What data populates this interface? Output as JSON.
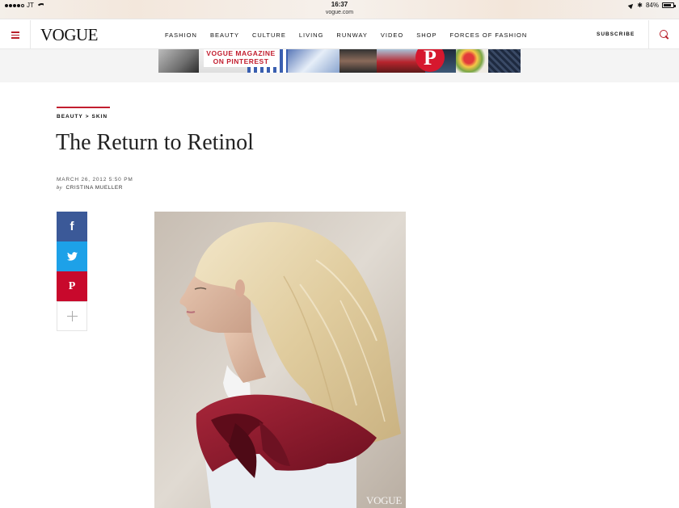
{
  "status_bar": {
    "carrier": "JT",
    "time": "16:37",
    "url": "vogue.com",
    "battery_percent": "84%",
    "battery_level": 0.84
  },
  "header": {
    "logo": "VOGUE",
    "nav": [
      "FASHION",
      "BEAUTY",
      "CULTURE",
      "LIVING",
      "RUNWAY",
      "VIDEO",
      "SHOP",
      "FORCES OF FASHION"
    ],
    "subscribe_label": "SUBSCRIBE",
    "accent_color": "#c21e2f"
  },
  "ad": {
    "title_line1": "VOGUE MAGAZINE",
    "title_line2": "ON PINTEREST",
    "pinterest_glyph": "P"
  },
  "article": {
    "breadcrumb_section": "BEAUTY",
    "breadcrumb_separator": ">",
    "breadcrumb_subsection": "SKIN",
    "title": "The Return to Retinol",
    "date": "MARCH 26, 2012 5:50 PM",
    "byline_prefix": "by",
    "author": "CRISTINA MUELLER",
    "image_watermark": "VOGUE"
  },
  "share": {
    "facebook_glyph": "f",
    "pinterest_glyph": "P",
    "facebook_color": "#3b5998",
    "twitter_color": "#1da1e8",
    "pinterest_color": "#c8092c"
  }
}
